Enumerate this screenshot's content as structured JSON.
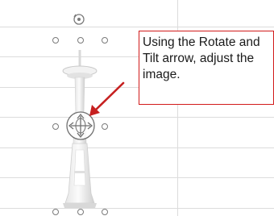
{
  "callout": {
    "lines": [
      "Using the Rotate and",
      "Tilt arrow, adjust the",
      "image."
    ]
  },
  "icons": {
    "rotate": "rotate-handle-icon",
    "tilt": "rotate-tilt-arrows-icon",
    "arrow": "callout-arrow-icon"
  },
  "colors": {
    "callout_border": "#d21a1a",
    "arrow": "#c62020",
    "gridline": "#dcdcdc",
    "handle": "#7a7a7a"
  }
}
